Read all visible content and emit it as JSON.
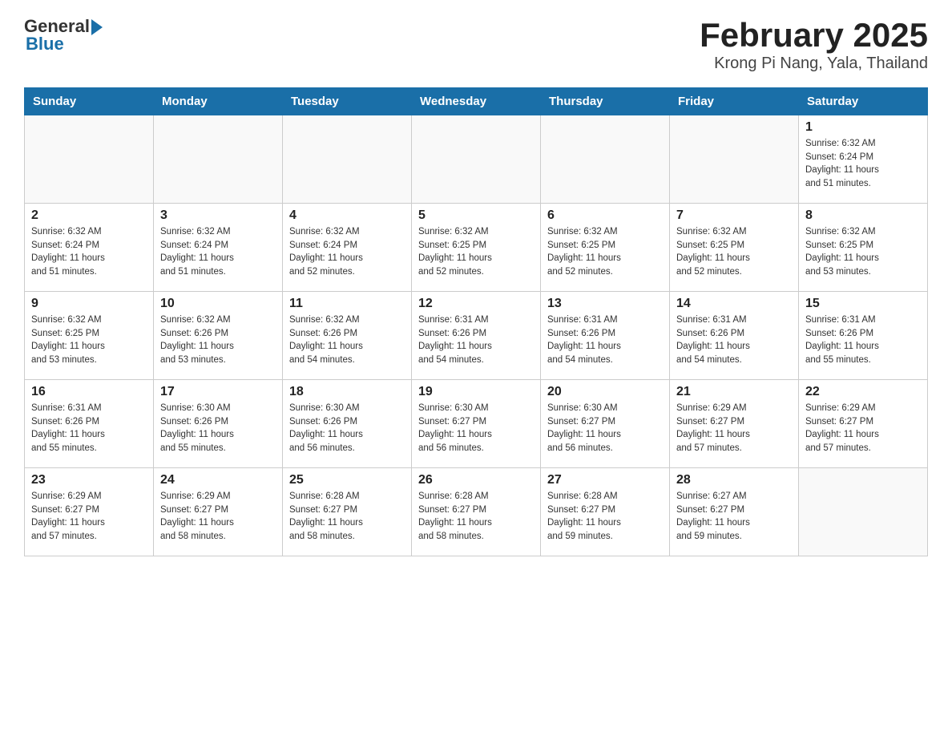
{
  "header": {
    "logo_general": "General",
    "logo_blue": "Blue",
    "title": "February 2025",
    "subtitle": "Krong Pi Nang, Yala, Thailand"
  },
  "days_of_week": [
    "Sunday",
    "Monday",
    "Tuesday",
    "Wednesday",
    "Thursday",
    "Friday",
    "Saturday"
  ],
  "weeks": [
    [
      {
        "day": "",
        "info": ""
      },
      {
        "day": "",
        "info": ""
      },
      {
        "day": "",
        "info": ""
      },
      {
        "day": "",
        "info": ""
      },
      {
        "day": "",
        "info": ""
      },
      {
        "day": "",
        "info": ""
      },
      {
        "day": "1",
        "info": "Sunrise: 6:32 AM\nSunset: 6:24 PM\nDaylight: 11 hours\nand 51 minutes."
      }
    ],
    [
      {
        "day": "2",
        "info": "Sunrise: 6:32 AM\nSunset: 6:24 PM\nDaylight: 11 hours\nand 51 minutes."
      },
      {
        "day": "3",
        "info": "Sunrise: 6:32 AM\nSunset: 6:24 PM\nDaylight: 11 hours\nand 51 minutes."
      },
      {
        "day": "4",
        "info": "Sunrise: 6:32 AM\nSunset: 6:24 PM\nDaylight: 11 hours\nand 52 minutes."
      },
      {
        "day": "5",
        "info": "Sunrise: 6:32 AM\nSunset: 6:25 PM\nDaylight: 11 hours\nand 52 minutes."
      },
      {
        "day": "6",
        "info": "Sunrise: 6:32 AM\nSunset: 6:25 PM\nDaylight: 11 hours\nand 52 minutes."
      },
      {
        "day": "7",
        "info": "Sunrise: 6:32 AM\nSunset: 6:25 PM\nDaylight: 11 hours\nand 52 minutes."
      },
      {
        "day": "8",
        "info": "Sunrise: 6:32 AM\nSunset: 6:25 PM\nDaylight: 11 hours\nand 53 minutes."
      }
    ],
    [
      {
        "day": "9",
        "info": "Sunrise: 6:32 AM\nSunset: 6:25 PM\nDaylight: 11 hours\nand 53 minutes."
      },
      {
        "day": "10",
        "info": "Sunrise: 6:32 AM\nSunset: 6:26 PM\nDaylight: 11 hours\nand 53 minutes."
      },
      {
        "day": "11",
        "info": "Sunrise: 6:32 AM\nSunset: 6:26 PM\nDaylight: 11 hours\nand 54 minutes."
      },
      {
        "day": "12",
        "info": "Sunrise: 6:31 AM\nSunset: 6:26 PM\nDaylight: 11 hours\nand 54 minutes."
      },
      {
        "day": "13",
        "info": "Sunrise: 6:31 AM\nSunset: 6:26 PM\nDaylight: 11 hours\nand 54 minutes."
      },
      {
        "day": "14",
        "info": "Sunrise: 6:31 AM\nSunset: 6:26 PM\nDaylight: 11 hours\nand 54 minutes."
      },
      {
        "day": "15",
        "info": "Sunrise: 6:31 AM\nSunset: 6:26 PM\nDaylight: 11 hours\nand 55 minutes."
      }
    ],
    [
      {
        "day": "16",
        "info": "Sunrise: 6:31 AM\nSunset: 6:26 PM\nDaylight: 11 hours\nand 55 minutes."
      },
      {
        "day": "17",
        "info": "Sunrise: 6:30 AM\nSunset: 6:26 PM\nDaylight: 11 hours\nand 55 minutes."
      },
      {
        "day": "18",
        "info": "Sunrise: 6:30 AM\nSunset: 6:26 PM\nDaylight: 11 hours\nand 56 minutes."
      },
      {
        "day": "19",
        "info": "Sunrise: 6:30 AM\nSunset: 6:27 PM\nDaylight: 11 hours\nand 56 minutes."
      },
      {
        "day": "20",
        "info": "Sunrise: 6:30 AM\nSunset: 6:27 PM\nDaylight: 11 hours\nand 56 minutes."
      },
      {
        "day": "21",
        "info": "Sunrise: 6:29 AM\nSunset: 6:27 PM\nDaylight: 11 hours\nand 57 minutes."
      },
      {
        "day": "22",
        "info": "Sunrise: 6:29 AM\nSunset: 6:27 PM\nDaylight: 11 hours\nand 57 minutes."
      }
    ],
    [
      {
        "day": "23",
        "info": "Sunrise: 6:29 AM\nSunset: 6:27 PM\nDaylight: 11 hours\nand 57 minutes."
      },
      {
        "day": "24",
        "info": "Sunrise: 6:29 AM\nSunset: 6:27 PM\nDaylight: 11 hours\nand 58 minutes."
      },
      {
        "day": "25",
        "info": "Sunrise: 6:28 AM\nSunset: 6:27 PM\nDaylight: 11 hours\nand 58 minutes."
      },
      {
        "day": "26",
        "info": "Sunrise: 6:28 AM\nSunset: 6:27 PM\nDaylight: 11 hours\nand 58 minutes."
      },
      {
        "day": "27",
        "info": "Sunrise: 6:28 AM\nSunset: 6:27 PM\nDaylight: 11 hours\nand 59 minutes."
      },
      {
        "day": "28",
        "info": "Sunrise: 6:27 AM\nSunset: 6:27 PM\nDaylight: 11 hours\nand 59 minutes."
      },
      {
        "day": "",
        "info": ""
      }
    ]
  ]
}
